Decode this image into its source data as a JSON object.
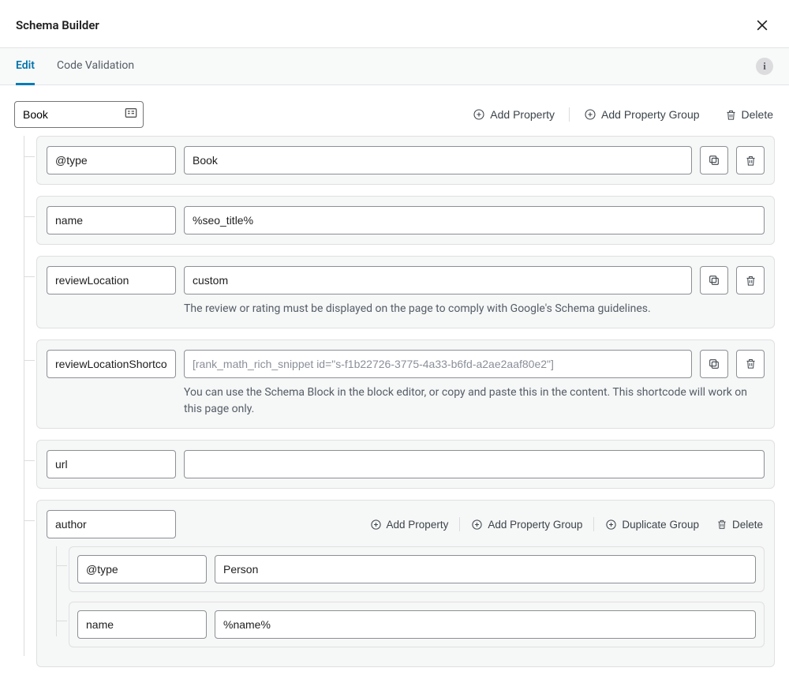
{
  "header": {
    "title": "Schema Builder"
  },
  "tabs": [
    {
      "label": "Edit",
      "active": true
    },
    {
      "label": "Code Validation",
      "active": false
    }
  ],
  "root": {
    "name": "Book"
  },
  "top_actions": {
    "add_property": "Add Property",
    "add_property_group": "Add Property Group",
    "delete": "Delete"
  },
  "properties": [
    {
      "key": "@type",
      "value": "Book",
      "show_copy": true,
      "show_delete": true
    },
    {
      "key": "name",
      "value": "%seo_title%",
      "show_copy": false,
      "show_delete": false
    },
    {
      "key": "reviewLocation",
      "value": "custom",
      "show_copy": true,
      "show_delete": true,
      "helper": "The review or rating must be displayed on the page to comply with Google's Schema guidelines."
    },
    {
      "key": "reviewLocationShortcode",
      "value": "",
      "placeholder": "[rank_math_rich_snippet id=\"s-f1b22726-3775-4a33-b6fd-a2ae2aaf80e2\"]",
      "show_copy": true,
      "show_delete": true,
      "helper": "You can use the Schema Block in the block editor, or copy and paste this in the content. This shortcode will work on this page only."
    },
    {
      "key": "url",
      "value": "",
      "show_copy": false,
      "show_delete": false
    }
  ],
  "group": {
    "name": "author",
    "actions": {
      "add_property": "Add Property",
      "add_property_group": "Add Property Group",
      "duplicate_group": "Duplicate Group",
      "delete": "Delete"
    },
    "properties": [
      {
        "key": "@type",
        "value": "Person"
      },
      {
        "key": "name",
        "value": "%name%"
      }
    ]
  }
}
